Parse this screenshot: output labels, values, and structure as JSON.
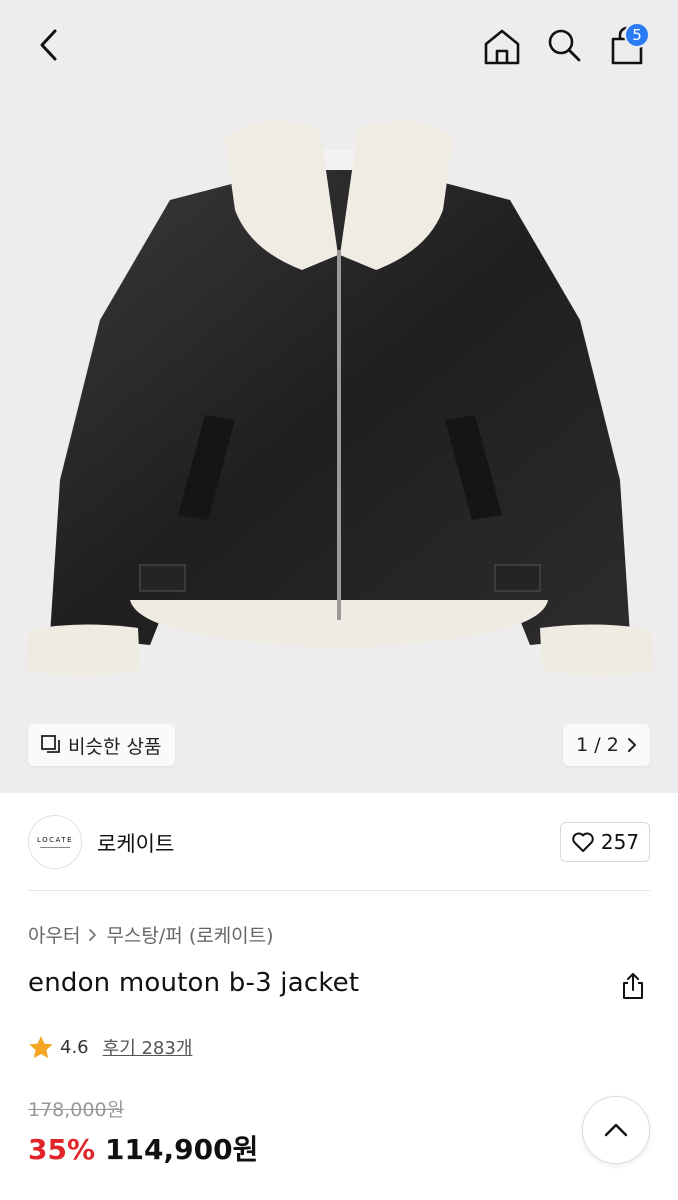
{
  "header": {
    "cart_count": "5",
    "icons": [
      "chevron-left-icon",
      "home-icon",
      "search-icon",
      "shopping-bag-icon"
    ]
  },
  "gallery": {
    "similar_label": "비슷한 상품",
    "page_indicator": "1 / 2"
  },
  "brand": {
    "logo_text": "LOCATE",
    "name": "로케이트",
    "likes": "257"
  },
  "breadcrumb": {
    "category": "아우터",
    "subcategory": "무스탕/퍼 (로케이트)"
  },
  "product": {
    "title": "endon mouton b-3 jacket",
    "rating": "4.6",
    "reviews_label": "후기 283개"
  },
  "price": {
    "original": "178,000원",
    "discount": "35%",
    "sale": "114,900원"
  },
  "colors": {
    "accent": "#2b7bf4",
    "discount_red": "#e0262a",
    "star": "#f4a623",
    "hero_bg": "#ededed"
  }
}
